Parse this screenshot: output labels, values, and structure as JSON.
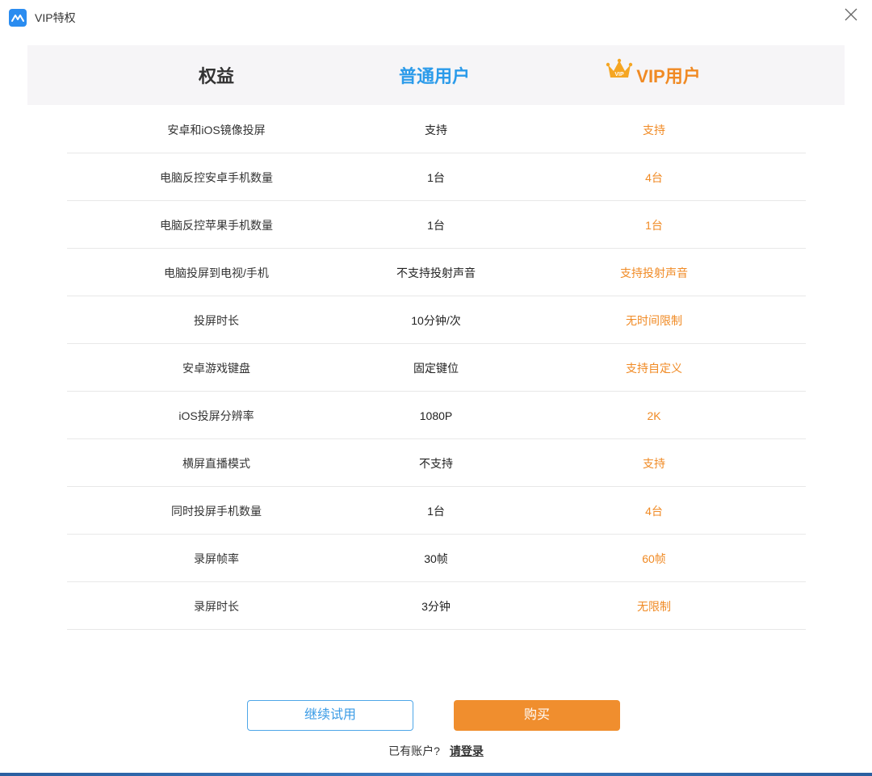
{
  "window": {
    "title": "VIP特权",
    "close_icon": "close-icon"
  },
  "header": {
    "col_rights": "权益",
    "col_normal": "普通用户",
    "col_vip": "VIP用户",
    "crown_icon": "vip-crown-icon"
  },
  "rows": [
    {
      "name": "安卓和iOS镜像投屏",
      "normal": "支持",
      "vip": "支持"
    },
    {
      "name": "电脑反控安卓手机数量",
      "normal": "1台",
      "vip": "4台"
    },
    {
      "name": "电脑反控苹果手机数量",
      "normal": "1台",
      "vip": "1台"
    },
    {
      "name": "电脑投屏到电视/手机",
      "normal": "不支持投射声音",
      "vip": "支持投射声音"
    },
    {
      "name": "投屏时长",
      "normal": "10分钟/次",
      "vip": "无时间限制"
    },
    {
      "name": "安卓游戏键盘",
      "normal": "固定键位",
      "vip": "支持自定义"
    },
    {
      "name": "iOS投屏分辨率",
      "normal": "1080P",
      "vip": "2K"
    },
    {
      "name": "横屏直播模式",
      "normal": "不支持",
      "vip": "支持"
    },
    {
      "name": "同时投屏手机数量",
      "normal": "1台",
      "vip": "4台"
    },
    {
      "name": "录屏帧率",
      "normal": "30帧",
      "vip": "60帧"
    },
    {
      "name": "录屏时长",
      "normal": "3分钟",
      "vip": "无限制"
    }
  ],
  "actions": {
    "trial_label": "继续试用",
    "buy_label": "购买",
    "has_account": "已有账户?",
    "login_label": "请登录"
  },
  "colors": {
    "accent_blue": "#2b9bea",
    "accent_orange": "#f08a24"
  }
}
